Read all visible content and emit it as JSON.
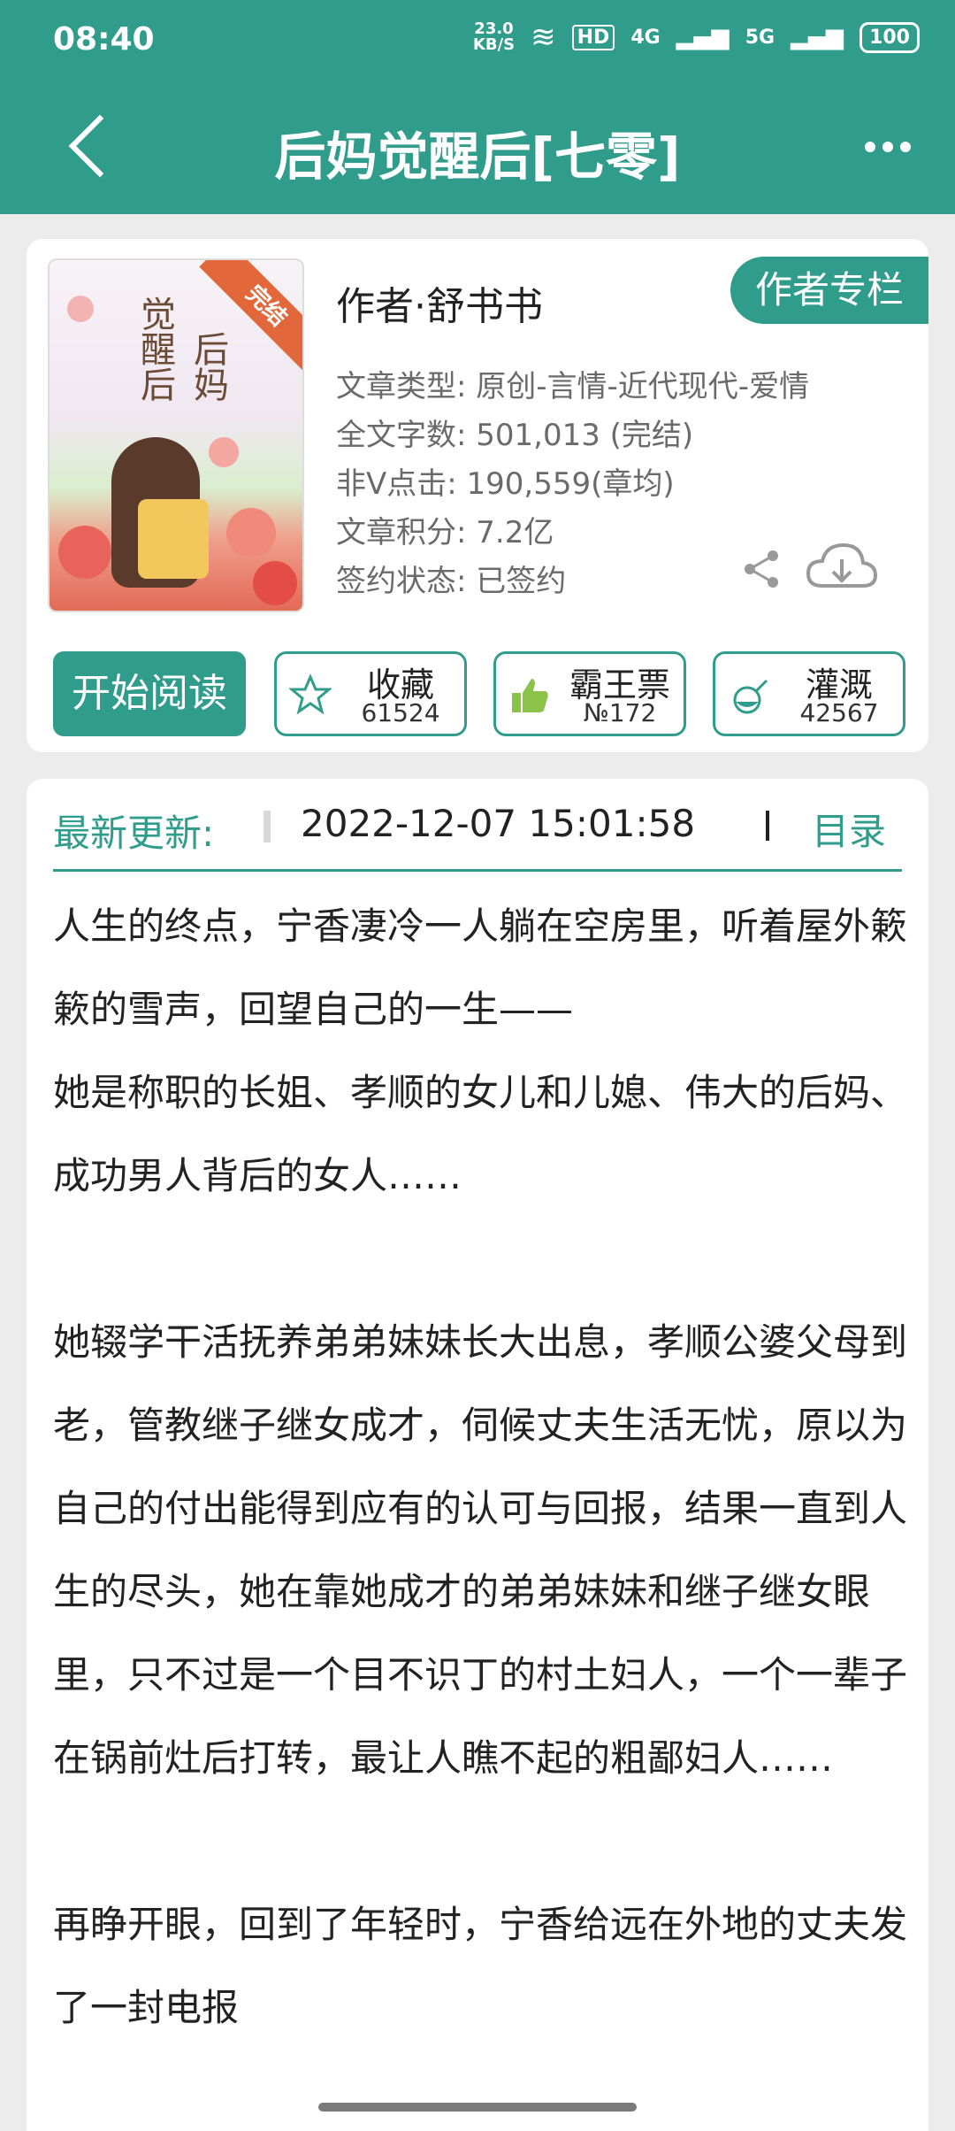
{
  "status_bar": {
    "time": "08:40",
    "net_speed": "23.0",
    "net_unit": "KB/S",
    "hd": "HD",
    "sig1": "4G",
    "sig2": "5G",
    "battery": "100"
  },
  "header": {
    "title": "后妈觉醒后[七零]"
  },
  "book": {
    "cover": {
      "badge": "完结",
      "line1": "后妈",
      "line2": "觉醒后"
    },
    "author": "作者·舒书书",
    "author_button": "作者专栏",
    "meta": [
      "文章类型: 原创-言情-近代现代-爱情",
      "全文字数: 501,013 (完结)",
      "非Ⅴ点击: 190,559(章均)",
      "文章积分: 7.2亿",
      "签约状态: 已签约"
    ]
  },
  "actions": {
    "read": "开始阅读",
    "collect": {
      "label": "收藏",
      "count": "61524"
    },
    "vote": {
      "label": "霸王票",
      "count": "№172"
    },
    "water": {
      "label": "灌溉",
      "count": "42567"
    }
  },
  "update": {
    "label": "最新更新:",
    "date": "2022-12-07 15:01:58",
    "toc": "目录"
  },
  "description": [
    "人生的终点，宁香凄冷一人躺在空房里，听着屋外簌簌的雪声，回望自己的一生——",
    "她是称职的长姐、孝顺的女儿和儿媳、伟大的后妈、成功男人背后的女人……",
    "",
    "她辍学干活抚养弟弟妹妹长大出息，孝顺公婆父母到老，管教继子继女成才，伺候丈夫生活无忧，原以为自己的付出能得到应有的认可与回报，结果一直到人生的尽头，她在靠她成才的弟弟妹妹和继子继女眼里，只不过是一个目不识丁的村土妇人，一个一辈子在锅前灶后打转，最让人瞧不起的粗鄙妇人……",
    "",
    "再睁开眼，回到了年轻时，宁香给远在外地的丈夫发了一封电报"
  ],
  "colors": {
    "accent": "#2f9c8c"
  }
}
